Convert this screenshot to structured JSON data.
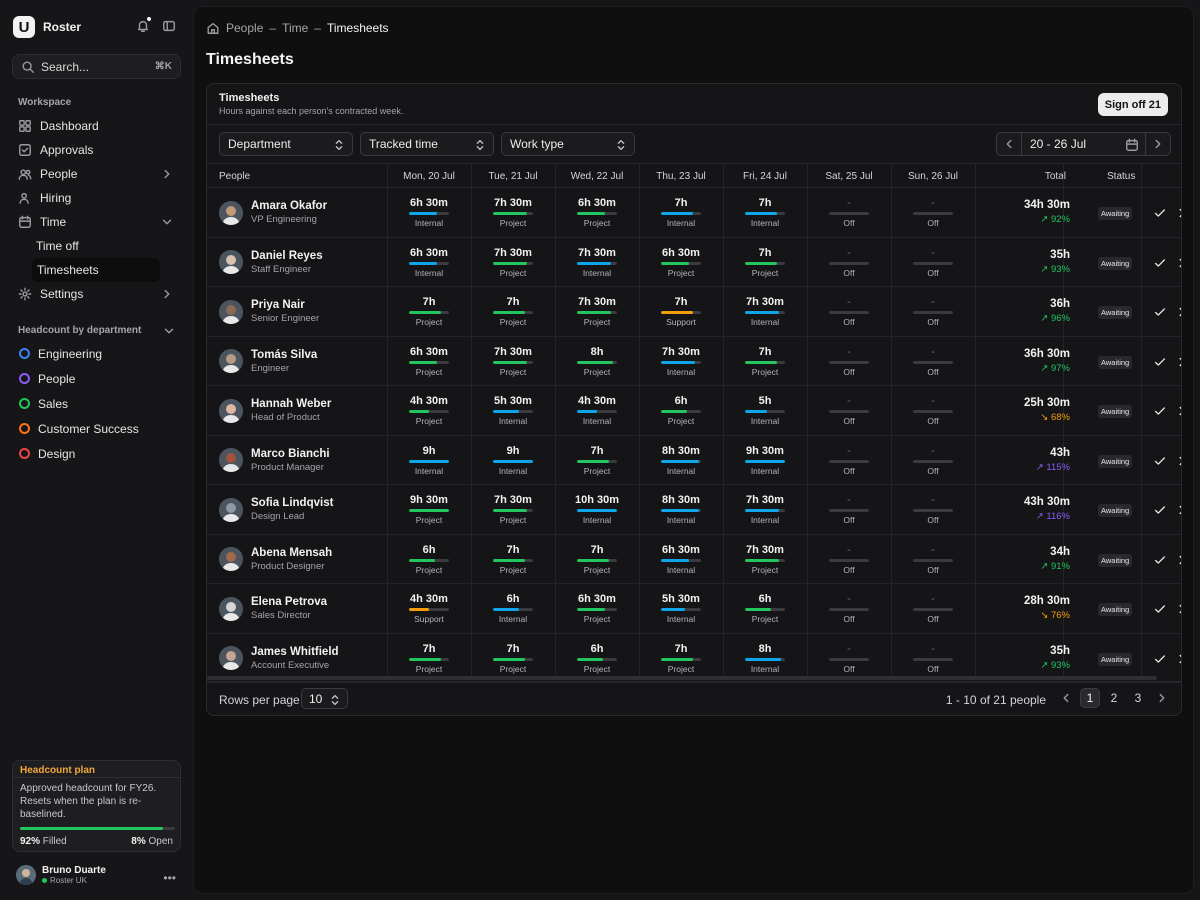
{
  "app": {
    "name": "Roster",
    "logo_letter": "U"
  },
  "search": {
    "placeholder": "Search...",
    "shortcut": "⌘K"
  },
  "sidebar": {
    "workspace_label": "Workspace",
    "items": [
      {
        "label": "Dashboard",
        "icon": "grid-icon"
      },
      {
        "label": "Approvals",
        "icon": "check-square-icon"
      },
      {
        "label": "People",
        "icon": "users-icon",
        "chevron": "right"
      },
      {
        "label": "Hiring",
        "icon": "user-plus-icon"
      },
      {
        "label": "Time",
        "icon": "calendar-icon",
        "chevron": "down"
      }
    ],
    "time_sub": [
      "Time off",
      "Timesheets"
    ],
    "settings_label": "Settings",
    "dept_label": "Headcount by department",
    "departments": [
      {
        "label": "Engineering",
        "color": "#3b82f6"
      },
      {
        "label": "People",
        "color": "#8b5cf6"
      },
      {
        "label": "Sales",
        "color": "#22c55e"
      },
      {
        "label": "Customer Success",
        "color": "#f97316"
      },
      {
        "label": "Design",
        "color": "#ef4444"
      }
    ],
    "plan": {
      "title": "Headcount plan",
      "desc": "Approved headcount for FY26. Resets when the plan is re-baselined.",
      "filled_pct": "92%",
      "filled_label": "Filled",
      "open_pct": "8%",
      "open_label": "Open",
      "filled_fraction": 0.92
    },
    "user": {
      "name": "Bruno Duarte",
      "org": "Roster UK"
    }
  },
  "breadcrumb": [
    "People",
    "Time",
    "Timesheets"
  ],
  "page_title": "Timesheets",
  "card": {
    "title": "Timesheets",
    "subtitle": "Hours against each person's contracted week.",
    "signoff_label": "Sign off 21"
  },
  "filters": {
    "department": "Department",
    "tracked": "Tracked time",
    "work_type": "Work type",
    "date_range": "20 - 26 Jul"
  },
  "columns": {
    "people": "People",
    "days": [
      "Mon, 20 Jul",
      "Tue, 21 Jul",
      "Wed, 22 Jul",
      "Thu, 23 Jul",
      "Fri, 24 Jul",
      "Sat, 25 Jul",
      "Sun, 26 Jul"
    ],
    "total": "Total",
    "status": "Status"
  },
  "type_colors": {
    "Internal": "#0ea5e9",
    "Project": "#22c55e",
    "Support": "#f59e0b"
  },
  "pct_colors": {
    "good": "#22c55e",
    "under": "#f59e0b",
    "over": "#8b5cf6"
  },
  "rows": [
    {
      "name": "Amara Okafor",
      "role": "VP Engineering",
      "days": [
        [
          "6h 30m",
          "Internal",
          0.7
        ],
        [
          "7h 30m",
          "Project",
          0.85
        ],
        [
          "6h 30m",
          "Project",
          0.7
        ],
        [
          "7h",
          "Internal",
          0.8
        ],
        [
          "7h",
          "Internal",
          0.8
        ],
        [
          "-",
          "Off",
          0
        ],
        [
          "-",
          "Off",
          0
        ]
      ],
      "total": "34h 30m",
      "pct": "92%",
      "trend": "good",
      "status": "Awaiting",
      "skin": "#c79a77"
    },
    {
      "name": "Daniel Reyes",
      "role": "Staff Engineer",
      "days": [
        [
          "6h 30m",
          "Internal",
          0.7
        ],
        [
          "7h 30m",
          "Project",
          0.85
        ],
        [
          "7h 30m",
          "Internal",
          0.85
        ],
        [
          "6h 30m",
          "Project",
          0.7
        ],
        [
          "7h",
          "Project",
          0.8
        ],
        [
          "-",
          "Off",
          0
        ],
        [
          "-",
          "Off",
          0
        ]
      ],
      "total": "35h",
      "pct": "93%",
      "trend": "good",
      "status": "Awaiting",
      "skin": "#d8c2ad"
    },
    {
      "name": "Priya Nair",
      "role": "Senior Engineer",
      "days": [
        [
          "7h",
          "Project",
          0.8
        ],
        [
          "7h",
          "Project",
          0.8
        ],
        [
          "7h 30m",
          "Project",
          0.85
        ],
        [
          "7h",
          "Support",
          0.8
        ],
        [
          "7h 30m",
          "Internal",
          0.85
        ],
        [
          "-",
          "Off",
          0
        ],
        [
          "-",
          "Off",
          0
        ]
      ],
      "total": "36h",
      "pct": "96%",
      "trend": "good",
      "status": "Awaiting",
      "skin": "#8a6a55"
    },
    {
      "name": "Tomás Silva",
      "role": "Engineer",
      "days": [
        [
          "6h 30m",
          "Project",
          0.7
        ],
        [
          "7h 30m",
          "Project",
          0.85
        ],
        [
          "8h",
          "Project",
          0.9
        ],
        [
          "7h 30m",
          "Internal",
          0.85
        ],
        [
          "7h",
          "Project",
          0.8
        ],
        [
          "-",
          "Off",
          0
        ],
        [
          "-",
          "Off",
          0
        ]
      ],
      "total": "36h 30m",
      "pct": "97%",
      "trend": "good",
      "status": "Awaiting",
      "skin": "#b89a86"
    },
    {
      "name": "Hannah Weber",
      "role": "Head of Product",
      "days": [
        [
          "4h 30m",
          "Project",
          0.5
        ],
        [
          "5h 30m",
          "Internal",
          0.65
        ],
        [
          "4h 30m",
          "Internal",
          0.5
        ],
        [
          "6h",
          "Project",
          0.65
        ],
        [
          "5h",
          "Internal",
          0.55
        ],
        [
          "-",
          "Off",
          0
        ],
        [
          "-",
          "Off",
          0
        ]
      ],
      "total": "25h 30m",
      "pct": "68%",
      "trend": "under",
      "status": "Awaiting",
      "skin": "#e0b7a4"
    },
    {
      "name": "Marco Bianchi",
      "role": "Product Manager",
      "days": [
        [
          "9h",
          "Internal",
          1
        ],
        [
          "9h",
          "Internal",
          1
        ],
        [
          "7h",
          "Project",
          0.8
        ],
        [
          "8h 30m",
          "Internal",
          0.95
        ],
        [
          "9h 30m",
          "Internal",
          1
        ],
        [
          "-",
          "Off",
          0
        ],
        [
          "-",
          "Off",
          0
        ]
      ],
      "total": "43h",
      "pct": "115%",
      "trend": "over",
      "status": "Awaiting",
      "skin": "#a0523d"
    },
    {
      "name": "Sofia Lindqvist",
      "role": "Design Lead",
      "days": [
        [
          "9h 30m",
          "Project",
          1
        ],
        [
          "7h 30m",
          "Project",
          0.85
        ],
        [
          "10h 30m",
          "Internal",
          1
        ],
        [
          "8h 30m",
          "Internal",
          0.95
        ],
        [
          "7h 30m",
          "Internal",
          0.85
        ],
        [
          "-",
          "Off",
          0
        ],
        [
          "-",
          "Off",
          0
        ]
      ],
      "total": "43h 30m",
      "pct": "116%",
      "trend": "over",
      "status": "Awaiting",
      "skin": "#8d9aa6"
    },
    {
      "name": "Abena Mensah",
      "role": "Product Designer",
      "days": [
        [
          "6h",
          "Project",
          0.65
        ],
        [
          "7h",
          "Project",
          0.8
        ],
        [
          "7h",
          "Project",
          0.8
        ],
        [
          "6h 30m",
          "Internal",
          0.7
        ],
        [
          "7h 30m",
          "Project",
          0.85
        ],
        [
          "-",
          "Off",
          0
        ],
        [
          "-",
          "Off",
          0
        ]
      ],
      "total": "34h",
      "pct": "91%",
      "trend": "good",
      "status": "Awaiting",
      "skin": "#a06a4a"
    },
    {
      "name": "Elena Petrova",
      "role": "Sales Director",
      "days": [
        [
          "4h 30m",
          "Support",
          0.5
        ],
        [
          "6h",
          "Internal",
          0.65
        ],
        [
          "6h 30m",
          "Project",
          0.7
        ],
        [
          "5h 30m",
          "Internal",
          0.6
        ],
        [
          "6h",
          "Project",
          0.65
        ],
        [
          "-",
          "Off",
          0
        ],
        [
          "-",
          "Off",
          0
        ]
      ],
      "total": "28h 30m",
      "pct": "76%",
      "trend": "under",
      "status": "Awaiting",
      "skin": "#d6d6d6"
    },
    {
      "name": "James Whitfield",
      "role": "Account Executive",
      "days": [
        [
          "7h",
          "Project",
          0.8
        ],
        [
          "7h",
          "Project",
          0.8
        ],
        [
          "6h",
          "Project",
          0.65
        ],
        [
          "7h",
          "Project",
          0.8
        ],
        [
          "8h",
          "Internal",
          0.9
        ],
        [
          "-",
          "Off",
          0
        ],
        [
          "-",
          "Off",
          0
        ]
      ],
      "total": "35h",
      "pct": "93%",
      "trend": "good",
      "status": "Awaiting",
      "skin": "#c4a590"
    }
  ],
  "footer": {
    "rows_per_page_label": "Rows per page",
    "rows_per_page": "10",
    "range": "1 - 10 of 21 people",
    "pages": [
      "1",
      "2",
      "3"
    ],
    "current_page": "1"
  }
}
